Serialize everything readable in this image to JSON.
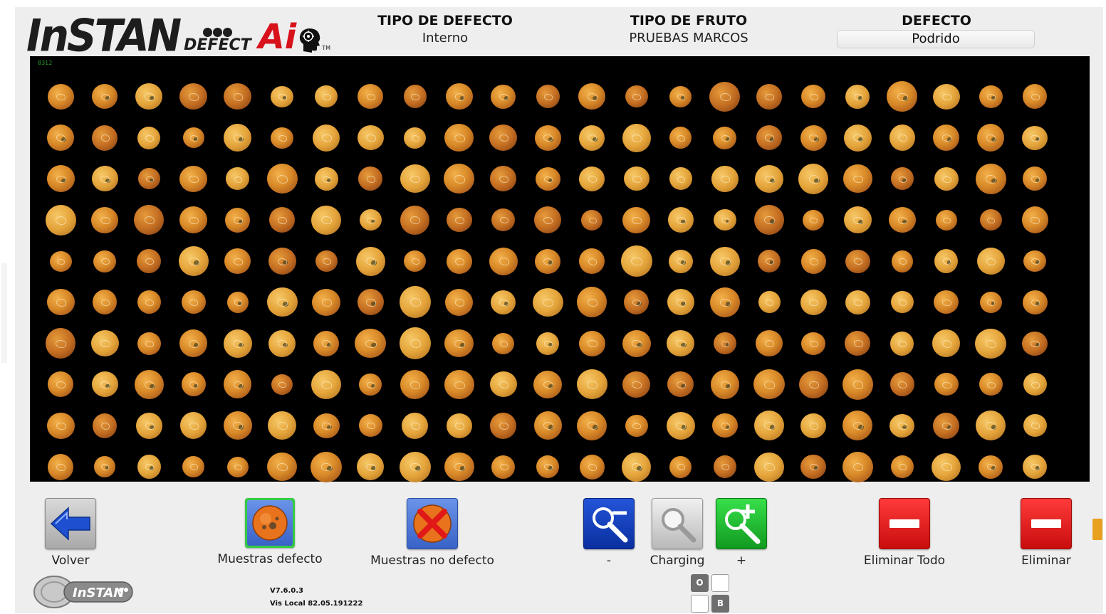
{
  "header": {
    "logo_text": "InSTAN",
    "logo_sub": "DEFECT",
    "logo_ai": "Ai",
    "logo_tm": "TM",
    "tipo_defecto": {
      "label": "TIPO DE DEFECTO",
      "value": "Interno"
    },
    "tipo_fruto": {
      "label": "TIPO DE FRUTO",
      "value": "PRUEBAS MARCOS"
    },
    "defecto": {
      "label": "DEFECTO",
      "value": "Podrido"
    }
  },
  "canvas": {
    "counter": "8312",
    "background": "#000000",
    "grid": {
      "columns": 23,
      "rows": 10,
      "sample_count": 230
    }
  },
  "toolbar": {
    "volver": {
      "label": "Volver",
      "icon": "arrow-left-icon"
    },
    "muestras_defecto": {
      "label": "Muestras defecto",
      "icon": "orange-defect-icon",
      "selected": true
    },
    "muestras_no_defecto": {
      "label": "Muestras no defecto",
      "icon": "orange-crossed-icon"
    },
    "zoom_out": {
      "label": "-",
      "icon": "zoom-out-icon"
    },
    "zoom_reset": {
      "label": "Charging",
      "icon": "magnifier-icon"
    },
    "zoom_in": {
      "label": "+",
      "icon": "zoom-in-icon"
    },
    "eliminar_todo": {
      "label": "Eliminar Todo",
      "icon": "minus-icon"
    },
    "eliminar": {
      "label": "Eliminar",
      "icon": "minus-icon"
    }
  },
  "footer": {
    "logo_text": "InSTAN",
    "version": "V7.6.0.3",
    "vis_local": "Vis Local 82.05.191222",
    "toggle_o": "O",
    "toggle_b": "B"
  },
  "colors": {
    "accent_green": "#33cc44",
    "danger_red": "#d8121b",
    "zoom_blue": "#0a2fa0",
    "fruit_orange": "#d98a28"
  }
}
